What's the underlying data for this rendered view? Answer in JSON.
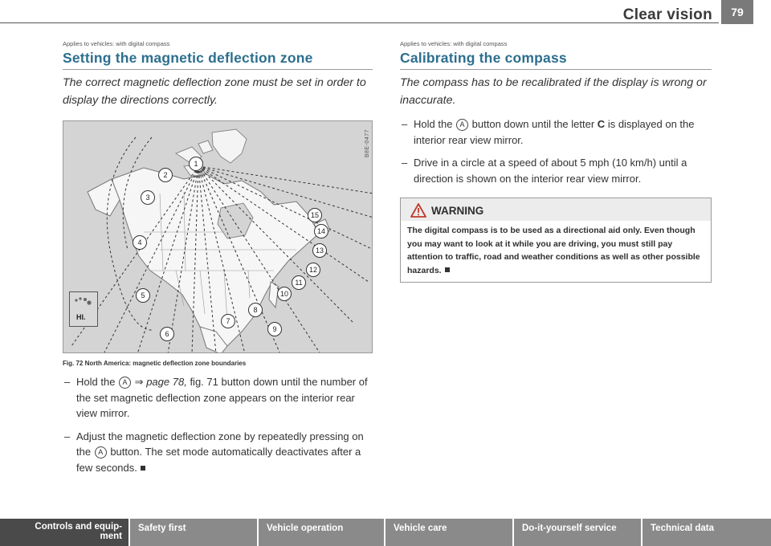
{
  "header": {
    "section_title": "Clear vision",
    "page_number": "79"
  },
  "left": {
    "applies": "Applies to vehicles: with digital compass",
    "heading": "Setting the magnetic deflection zone",
    "intro": "The correct magnetic deflection zone must be set in order to display the directions correctly.",
    "figure": {
      "code": "B8E-0477",
      "zone_numbers": [
        "1",
        "2",
        "3",
        "4",
        "5",
        "6",
        "7",
        "8",
        "9",
        "10",
        "11",
        "12",
        "13",
        "14",
        "15"
      ],
      "inset_label": "HI.",
      "caption": "Fig. 72  North America: magnetic deflection zone boundaries"
    },
    "step1": {
      "pre": "Hold the",
      "button": "A",
      "arrow": "⇒",
      "ref": "page 78,",
      "post": "fig. 71 button down until the number of the set magnetic deflection zone appears on the interior rear view mirror."
    },
    "step2": {
      "pre": "Adjust the magnetic deflection zone by repeatedly pressing on the",
      "button": "A",
      "post": "button. The set mode automatically deactivates after a few seconds."
    }
  },
  "right": {
    "applies": "Applies to vehicles: with digital compass",
    "heading": "Calibrating the compass",
    "intro": "The compass has to be recalibrated if the display is wrong or inaccurate.",
    "step1": {
      "pre": "Hold the",
      "button": "A",
      "mid": "button down until the letter",
      "letter": "C",
      "post": "is displayed on the interior rear view mirror."
    },
    "step2": "Drive in a circle at a speed of about 5 mph (10 km/h) until a direction is shown on the interior rear view mirror.",
    "warning": {
      "title": "WARNING",
      "text": "The digital compass is to be used as a directional aid only. Even though you may want to look at it while you are driving, you must still pay attention to traffic, road and weather conditions as well as other possible hazards."
    }
  },
  "footer": {
    "tabs": [
      "Controls and equip-\nment",
      "Safety first",
      "Vehicle operation",
      "Vehicle care",
      "Do-it-yourself service",
      "Technical data"
    ]
  },
  "colors": {
    "heading_blue": "#2c6f8f",
    "footer_active": "#4a4a4a",
    "footer_tab": "#8a8a8a"
  }
}
